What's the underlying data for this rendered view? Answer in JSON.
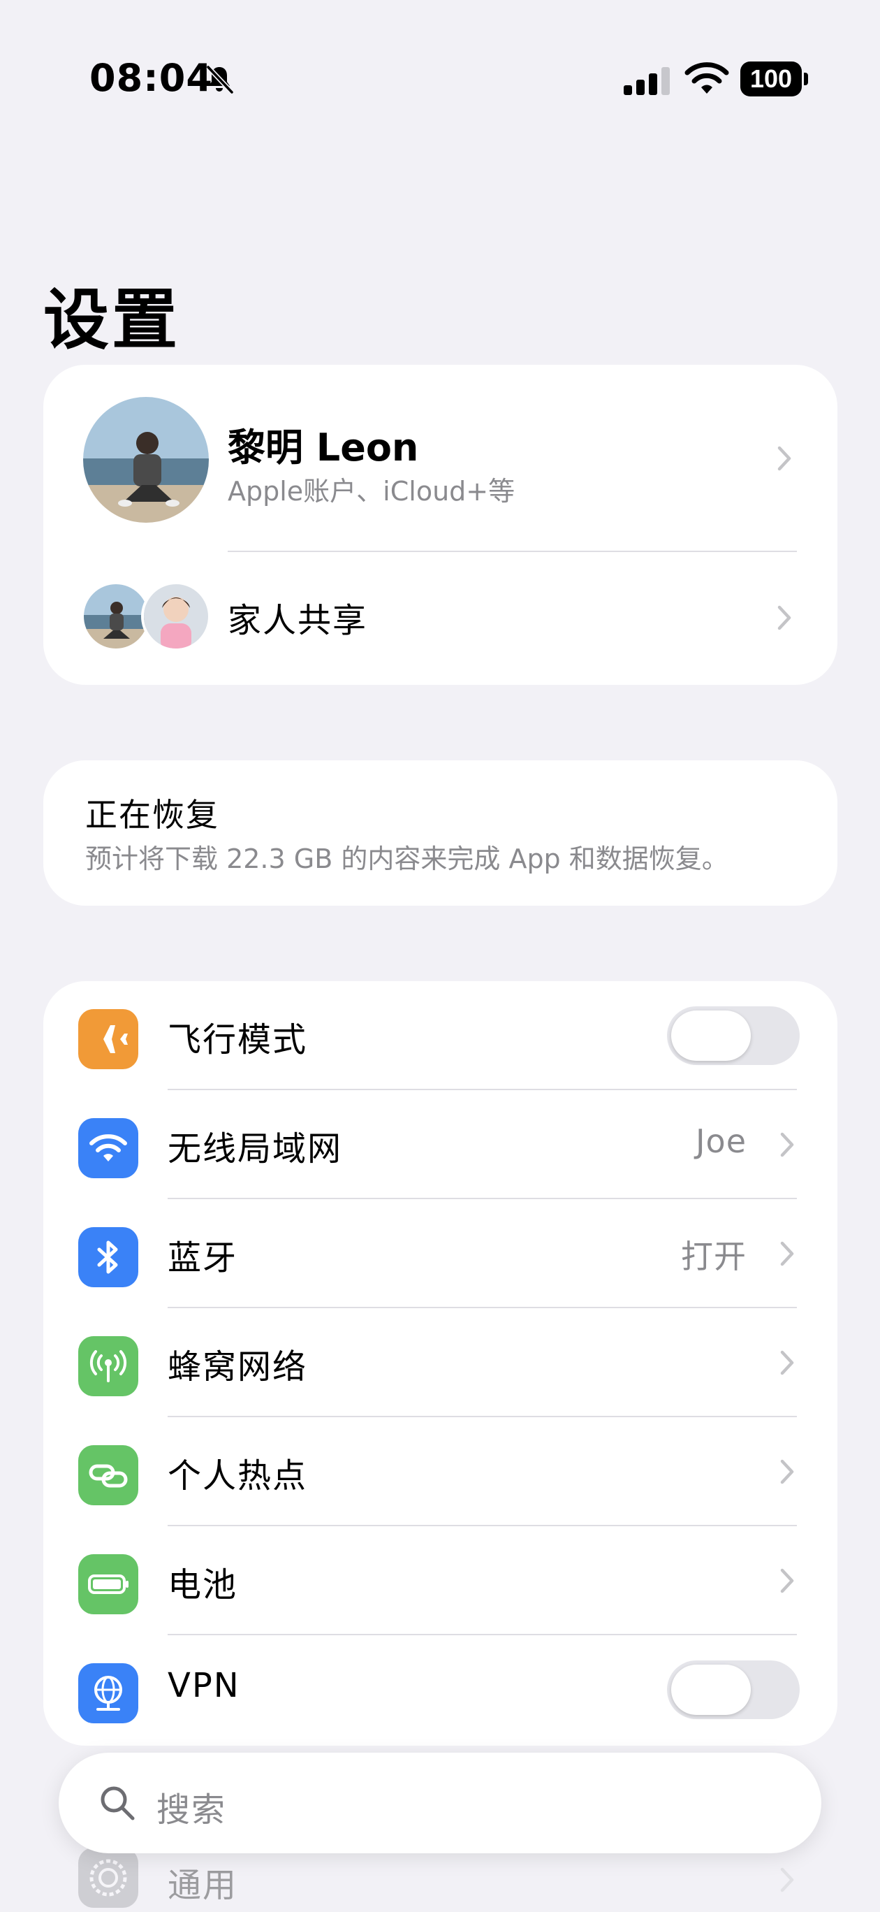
{
  "status_bar": {
    "time": "08:04",
    "battery": "100"
  },
  "title": "设置",
  "account": {
    "name": "黎明 Leon",
    "subtitle": "Apple账户、iCloud+等",
    "family_label": "家人共享"
  },
  "restore": {
    "title": "正在恢复",
    "description": "预计将下载 22.3 GB 的内容来完成 App 和数据恢复。"
  },
  "settings": [
    {
      "label": "飞行模式",
      "icon": "airplane-icon",
      "color": "#f19a37",
      "control": "toggle",
      "on": false
    },
    {
      "label": "无线局域网",
      "icon": "wifi-icon",
      "color": "#3a82f7",
      "value": "Joe"
    },
    {
      "label": "蓝牙",
      "icon": "bluetooth-icon",
      "color": "#3a82f7",
      "value": "打开"
    },
    {
      "label": "蜂窝网络",
      "icon": "cellular-icon",
      "color": "#65c466"
    },
    {
      "label": "个人热点",
      "icon": "hotspot-icon",
      "color": "#65c466"
    },
    {
      "label": "电池",
      "icon": "battery-icon",
      "color": "#65c466"
    },
    {
      "label": "VPN",
      "icon": "vpn-globe-icon",
      "color": "#3a82f7",
      "control": "toggle",
      "on": false
    }
  ],
  "search": {
    "placeholder": "搜索"
  },
  "peek_row": {
    "label": "通用",
    "icon": "gear-icon",
    "color": "#8e8e93"
  }
}
